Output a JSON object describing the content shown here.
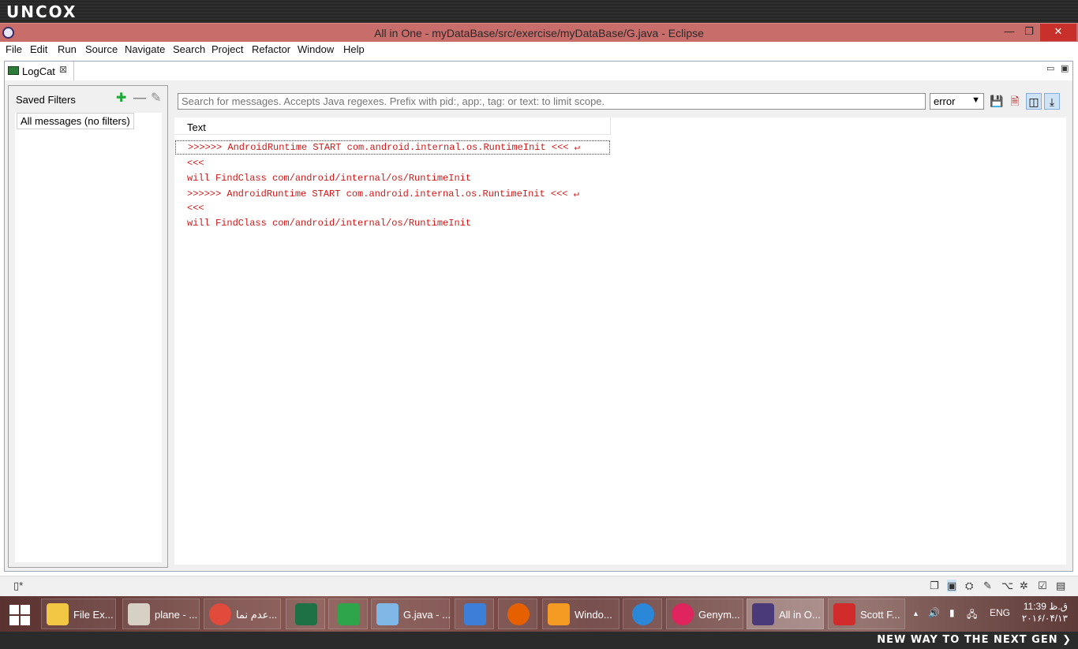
{
  "brand": "UNCOX",
  "slogan": "NEW WAY TO THE NEXT GEN ❯",
  "window": {
    "title": "All in One - myDataBase/src/exercise/myDataBase/G.java - Eclipse",
    "minimize": "—",
    "restore": "❐",
    "close": "✕"
  },
  "menu": [
    "File",
    "Edit",
    "Run",
    "Source",
    "Navigate",
    "Search",
    "Project",
    "Refactor",
    "Window",
    "Help"
  ],
  "view": {
    "tab_label": "LogCat",
    "tab_close": "⊠",
    "minimize": "▭",
    "maximize": "▣"
  },
  "filters": {
    "heading": "Saved Filters",
    "add": "✚",
    "remove": "—",
    "edit": "✎",
    "items": [
      "All messages (no filters)"
    ]
  },
  "log": {
    "search_placeholder": "Search for messages. Accepts Java regexes. Prefix with pid:, app:, tag: or text: to limit scope.",
    "level": "error",
    "level_arrow": "▼",
    "column_header": "Text",
    "rows": [
      ">>>>>> AndroidRuntime START com.android.internal.os.RuntimeInit <<< ↵",
      "<<<",
      "will FindClass com/android/internal/os/RuntimeInit",
      ">>>>>> AndroidRuntime START com.android.internal.os.RuntimeInit <<< ↵",
      "<<<",
      "will FindClass com/android/internal/os/RuntimeInit"
    ],
    "tool_save": "💾",
    "tool_clear": "🗎",
    "tool_toggle_panel": "◫",
    "tool_scroll_lock": "⤓"
  },
  "statusbar": {
    "left_icon": "▯*",
    "icons": [
      "❐",
      "▣",
      "⛭",
      "✎",
      "⌥",
      "✲",
      "☑",
      "▤"
    ]
  },
  "taskbar": {
    "items": [
      {
        "label": "File Ex...",
        "icon": "folder-icon",
        "color": "#f2c744"
      },
      {
        "label": "plane - ...",
        "icon": "book-icon",
        "color": "#d7d0c4"
      },
      {
        "label": "عدم نما...",
        "icon": "chrome-icon",
        "color": "#e14b3b"
      },
      {
        "label": "",
        "icon": "excel-icon",
        "color": "#1e7145"
      },
      {
        "label": "",
        "icon": "calculator-icon",
        "color": "#2ea54a"
      },
      {
        "label": "G.java - ...",
        "icon": "notepad-icon",
        "color": "#7fb7e6"
      },
      {
        "label": "",
        "icon": "lightning-icon",
        "color": "#3b7fd8"
      },
      {
        "label": "",
        "icon": "firefox-icon",
        "color": "#e66000"
      },
      {
        "label": "Windo...",
        "icon": "media-icon",
        "color": "#f59a23"
      },
      {
        "label": "",
        "icon": "play-icon",
        "color": "#2b88d8"
      },
      {
        "label": "Genym...",
        "icon": "genymotion-icon",
        "color": "#e0245e"
      },
      {
        "label": "All in O...",
        "icon": "eclipse-icon",
        "color": "#4b3a7a"
      },
      {
        "label": "Scott F...",
        "icon": "pdf-icon",
        "color": "#d22b2b"
      }
    ],
    "tray_arrow": "▲",
    "tray_volume": "🔊",
    "tray_battery": "▮",
    "tray_network": "🖧",
    "language": "ENG",
    "time": "11:39 ق.ظ",
    "date": "۲۰۱۶/۰۴/۱۳"
  }
}
